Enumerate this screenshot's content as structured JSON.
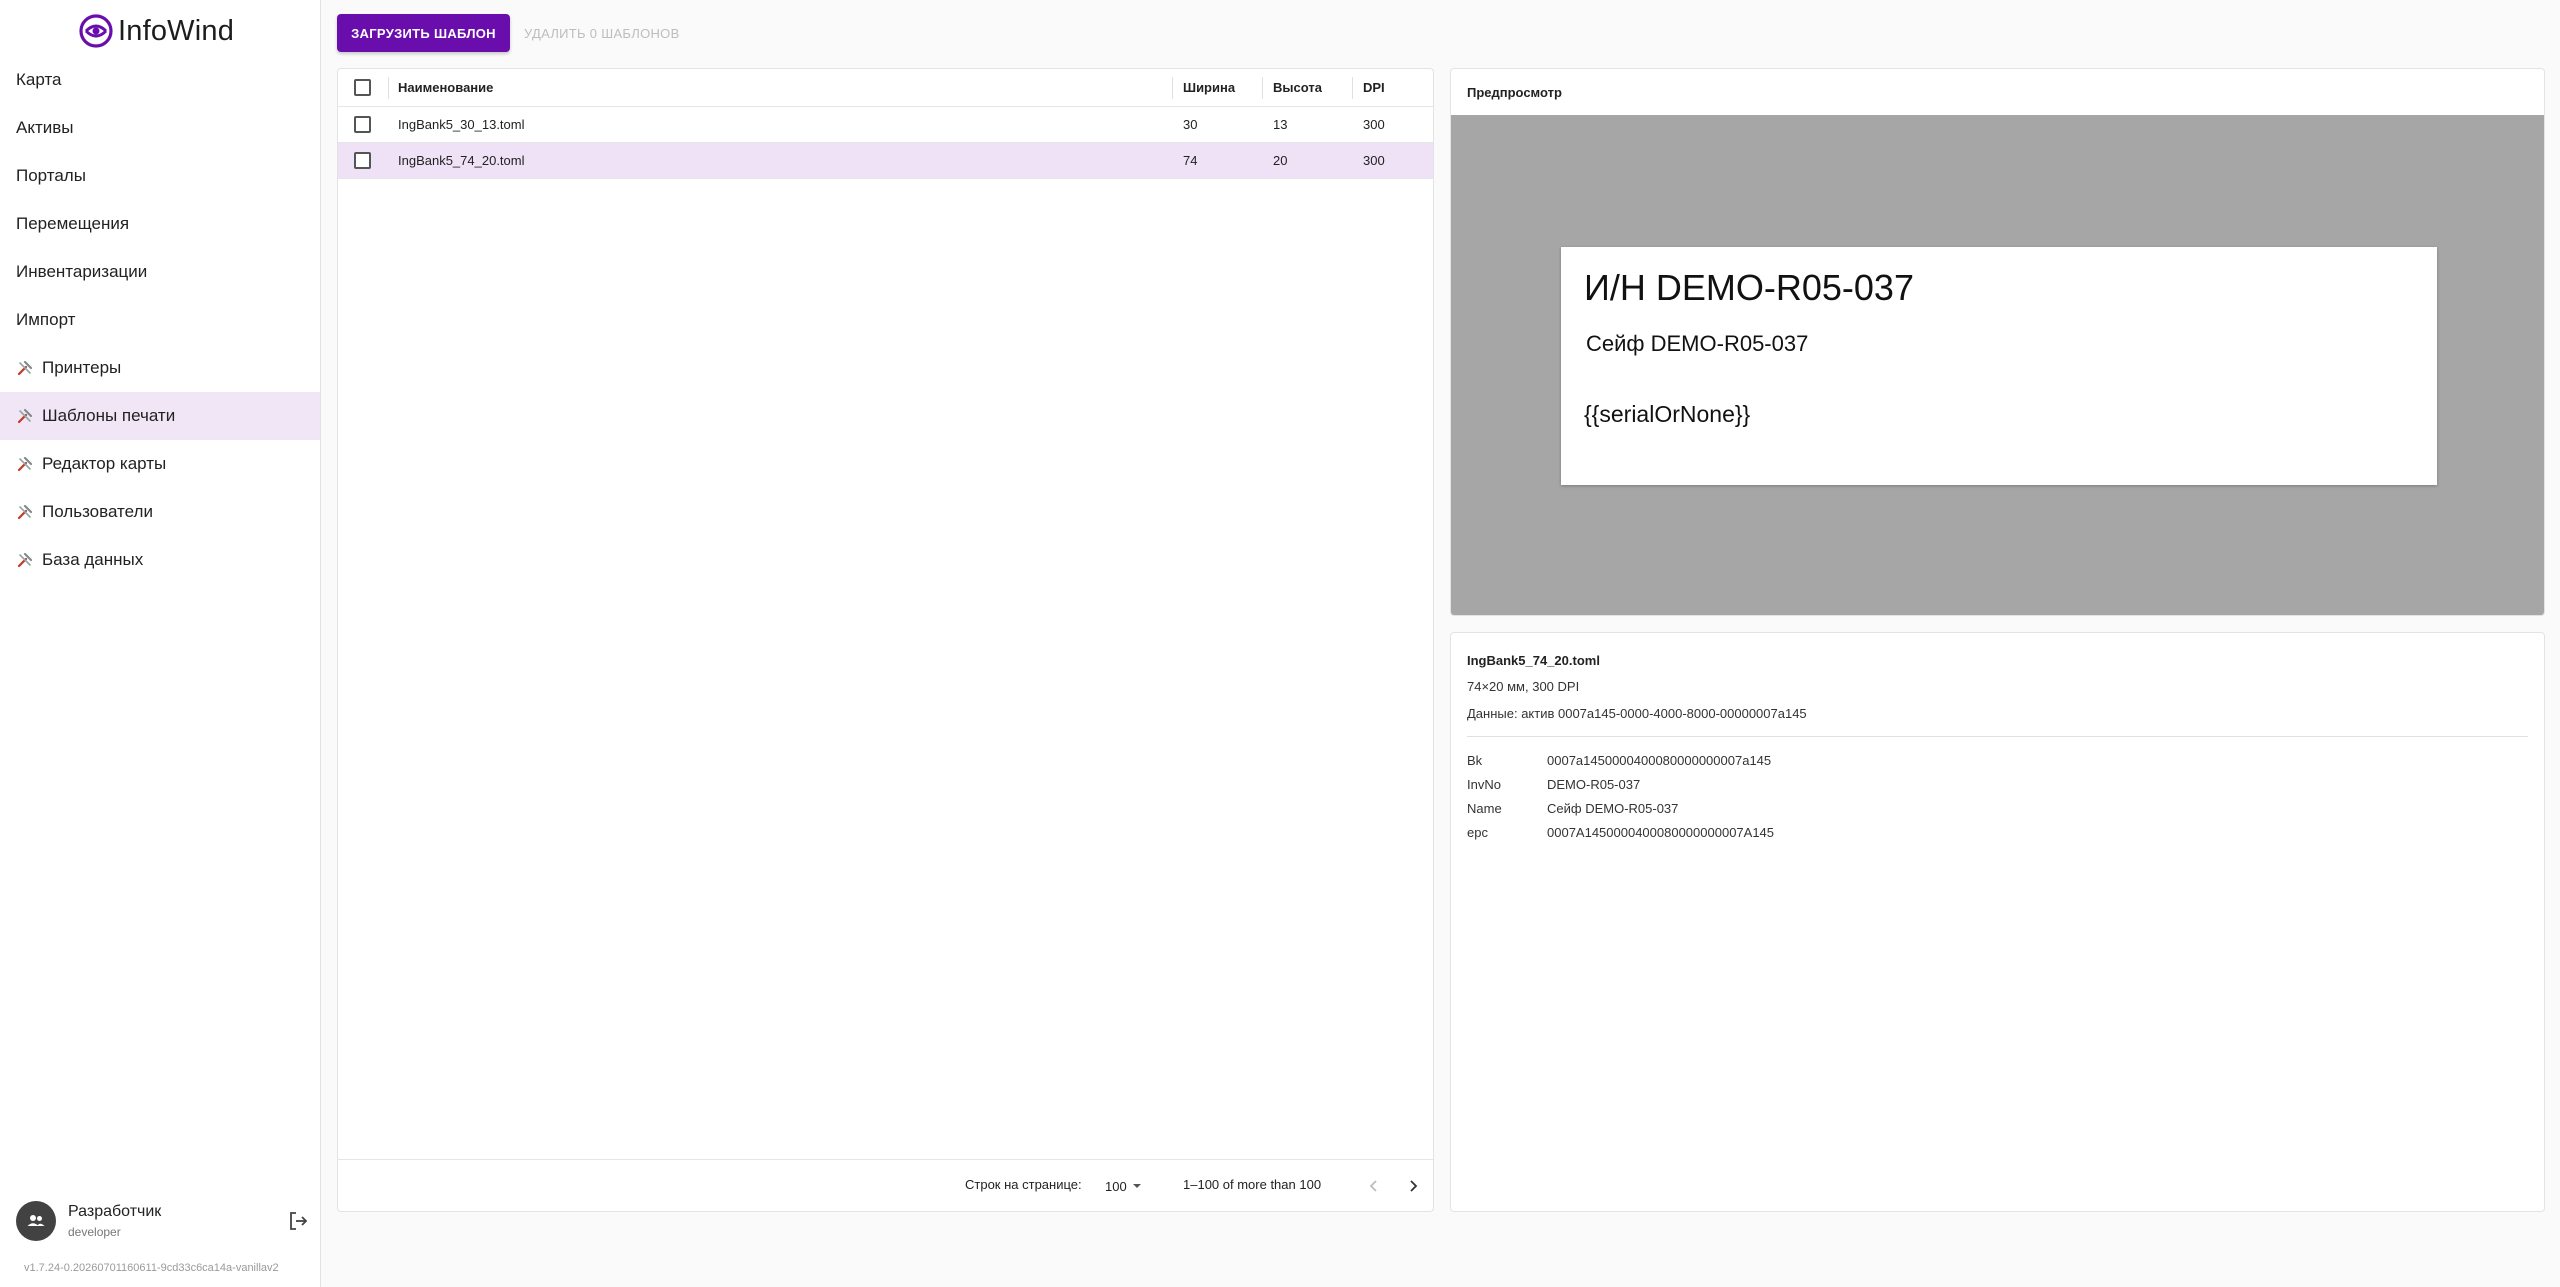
{
  "app": {
    "logo_text": "InfoWind",
    "brand_color": "#6a0dad"
  },
  "sidebar": {
    "items": [
      {
        "label": "Карта",
        "tool": false
      },
      {
        "label": "Активы",
        "tool": false
      },
      {
        "label": "Порталы",
        "tool": false
      },
      {
        "label": "Перемещения",
        "tool": false
      },
      {
        "label": "Инвентаризации",
        "tool": false
      },
      {
        "label": "Импорт",
        "tool": false
      },
      {
        "label": "Принтеры",
        "tool": true
      },
      {
        "label": "Шаблоны печати",
        "tool": true,
        "active": true
      },
      {
        "label": "Редактор карты",
        "tool": true
      },
      {
        "label": "Пользователи",
        "tool": true
      },
      {
        "label": "База данных",
        "tool": true
      }
    ],
    "user": {
      "name": "Разработчик",
      "login": "developer"
    },
    "version": "v1.7.24-0.20260701160611-9cd33c6ca14a-vanillav2"
  },
  "toolbar": {
    "upload_label": "ЗАГРУЗИТЬ ШАБЛОН",
    "delete_label": "УДАЛИТЬ 0 ШАБЛОНОВ"
  },
  "table": {
    "columns": [
      "Наименование",
      "Ширина",
      "Высота",
      "DPI"
    ],
    "rows": [
      {
        "name": "IngBank5_30_13.toml",
        "width": "30",
        "height": "13",
        "dpi": "300",
        "selected": false
      },
      {
        "name": "IngBank5_74_20.toml",
        "width": "74",
        "height": "20",
        "dpi": "300",
        "selected": true
      }
    ],
    "footer": {
      "rows_per_page_label": "Строк на странице:",
      "rows_per_page": "100",
      "range": "1–100 of more than 100"
    }
  },
  "preview": {
    "title": "Предпросмотр",
    "label": {
      "invno": "И/Н DEMO-R05-037",
      "name": "Сейф DEMO-R05-037",
      "serial": "{{serialOrNone}}"
    }
  },
  "details": {
    "file": "IngBank5_74_20.toml",
    "size": "74×20 мм, 300 DPI",
    "data": "Данные: актив 0007a145-0000-4000-8000-00000007a145",
    "fields": [
      {
        "key": "Bk",
        "value": "0007a1450000400080000000007a145"
      },
      {
        "key": "InvNo",
        "value": "DEMO-R05-037"
      },
      {
        "key": "Name",
        "value": "Сейф DEMO-R05-037"
      },
      {
        "key": "epc",
        "value": "0007A1450000400080000000007A145"
      }
    ]
  }
}
